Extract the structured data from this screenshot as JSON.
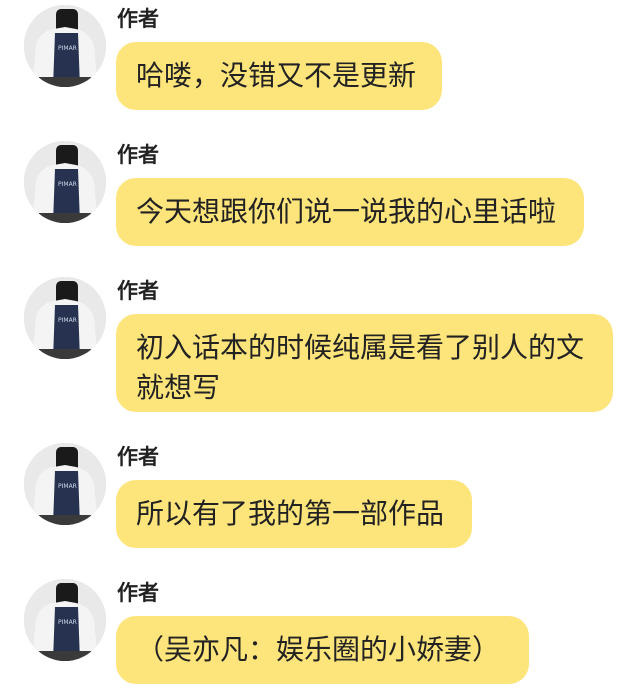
{
  "messages": [
    {
      "author": "作者",
      "text": "哈喽，没错又不是更新"
    },
    {
      "author": "作者",
      "text": "今天想跟你们说一说我的心里话啦"
    },
    {
      "author": "作者",
      "text": "初入话本的时候纯属是看了别人的文就想写"
    },
    {
      "author": "作者",
      "text": "所以有了我的第一部作品"
    },
    {
      "author": "作者",
      "text": "（吴亦凡：娱乐圈的小娇妻）"
    }
  ],
  "colors": {
    "bubble": "#fde57c",
    "text": "#222222",
    "background": "#ffffff"
  }
}
